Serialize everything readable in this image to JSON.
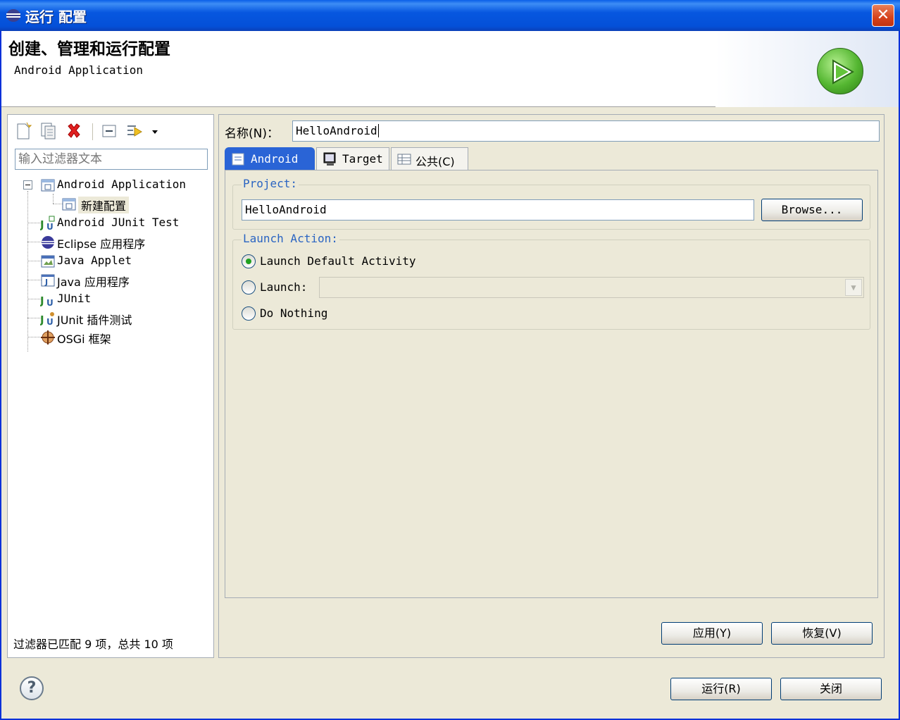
{
  "window": {
    "title": "运行 配置",
    "close_glyph": "✕"
  },
  "header": {
    "title": "创建、管理和运行配置",
    "subtitle": "Android Application",
    "icon": "run-icon"
  },
  "left": {
    "toolbar_icons": [
      "new-config-icon",
      "duplicate-icon",
      "delete-icon",
      "collapse-all-icon",
      "filter-icon",
      "dropdown-arrow-icon"
    ],
    "filter_placeholder": "输入过滤器文本",
    "tree": [
      {
        "label": "Android Application",
        "icon": "android-app-icon",
        "level": 0,
        "expanded": true
      },
      {
        "label": "新建配置",
        "icon": "config-icon",
        "level": 1,
        "selected": true
      },
      {
        "label": "Android JUnit Test",
        "icon": "junit-android-icon",
        "level": 0
      },
      {
        "label": "Eclipse 应用程序",
        "icon": "eclipse-icon",
        "level": 0
      },
      {
        "label": "Java Applet",
        "icon": "applet-icon",
        "level": 0
      },
      {
        "label": "Java 应用程序",
        "icon": "java-app-icon",
        "level": 0
      },
      {
        "label": "JUnit",
        "icon": "junit-icon",
        "level": 0
      },
      {
        "label": "JUnit 插件测试",
        "icon": "junit-plugin-icon",
        "level": 0
      },
      {
        "label": "OSGi 框架",
        "icon": "osgi-icon",
        "level": 0
      }
    ],
    "status": "过滤器已匹配 9 项，总共 10 项"
  },
  "right": {
    "name_label": "名称(N)：",
    "name_value": "HelloAndroid",
    "tabs": [
      {
        "label": "Android",
        "icon": "android-tab-icon",
        "active": true
      },
      {
        "label": "Target",
        "icon": "target-tab-icon"
      },
      {
        "label": "公共(C)",
        "icon": "common-tab-icon"
      }
    ],
    "project_group": "Project:",
    "project_value": "HelloAndroid",
    "browse": "Browse...",
    "launch_group": "Launch Action:",
    "radio_default": "Launch Default Activity",
    "radio_launch": "Launch:",
    "radio_nothing": "Do Nothing",
    "launch_select_value": "",
    "apply": "应用(Y)",
    "revert": "恢复(V)"
  },
  "footer": {
    "help_glyph": "?",
    "run": "运行(R)",
    "close": "关闭"
  },
  "colors": {
    "title_bar": "#0757e0",
    "tab_active": "#2a64d6",
    "group_title": "#2a64c2",
    "dialog_bg": "#ece9d8"
  }
}
